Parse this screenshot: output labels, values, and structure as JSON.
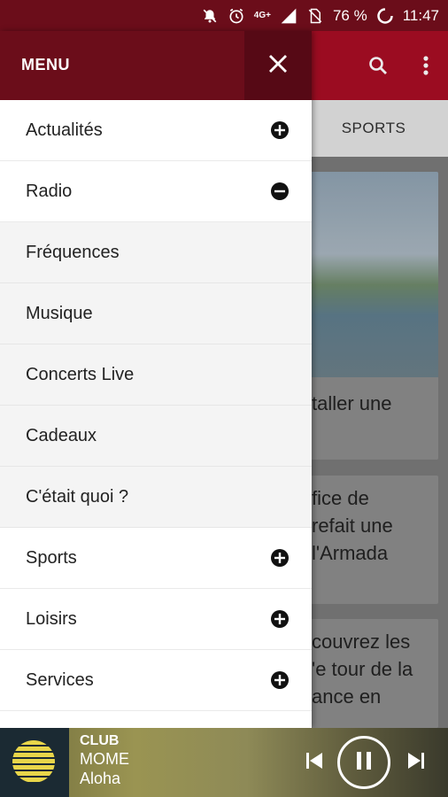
{
  "status_bar": {
    "network": "4G+",
    "battery": "76 %",
    "time": "11:47"
  },
  "drawer": {
    "title": "MENU",
    "items": [
      {
        "label": "Actualités",
        "toggle": "plus",
        "sub": false
      },
      {
        "label": "Radio",
        "toggle": "minus",
        "sub": false
      },
      {
        "label": "Fréquences",
        "toggle": "",
        "sub": true
      },
      {
        "label": "Musique",
        "toggle": "",
        "sub": true
      },
      {
        "label": "Concerts Live",
        "toggle": "",
        "sub": true
      },
      {
        "label": "Cadeaux",
        "toggle": "",
        "sub": true
      },
      {
        "label": "C'était quoi ?",
        "toggle": "",
        "sub": true
      },
      {
        "label": "Sports",
        "toggle": "plus",
        "sub": false
      },
      {
        "label": "Loisirs",
        "toggle": "plus",
        "sub": false
      },
      {
        "label": "Services",
        "toggle": "plus",
        "sub": false
      }
    ]
  },
  "tabs": {
    "visible": "SPORTS"
  },
  "feed": {
    "cards": [
      {
        "text": "taller une"
      },
      {
        "text": "fice de\nrefait une\nl'Armada"
      },
      {
        "text": "couvrez les\n'e tour de la\nance en"
      }
    ]
  },
  "player": {
    "show": "CLUB",
    "artist": "MOME",
    "title": "Aloha"
  },
  "colors": {
    "appbar": "#a90e24",
    "drawer_header": "#6b0d1a",
    "close_bg": "#560915"
  }
}
